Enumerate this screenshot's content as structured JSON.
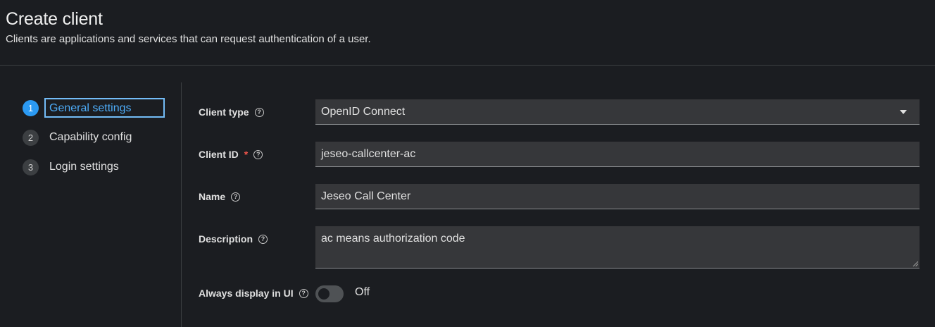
{
  "header": {
    "title": "Create client",
    "subtitle": "Clients are applications and services that can request authentication of a user."
  },
  "wizard": {
    "steps": [
      {
        "number": "1",
        "label": "General settings",
        "current": true
      },
      {
        "number": "2",
        "label": "Capability config",
        "current": false
      },
      {
        "number": "3",
        "label": "Login settings",
        "current": false
      }
    ]
  },
  "form": {
    "client_type": {
      "label": "Client type",
      "value": "OpenID Connect"
    },
    "client_id": {
      "label": "Client ID",
      "required_marker": "*",
      "value": "jeseo-callcenter-ac"
    },
    "name": {
      "label": "Name",
      "value": "Jeseo Call Center"
    },
    "description": {
      "label": "Description",
      "value": "ac means authorization code"
    },
    "always_display": {
      "label": "Always display in UI",
      "state_text": "Off",
      "checked": false
    }
  },
  "icons": {
    "help": "help-circle-icon",
    "dropdown": "caret-down-icon"
  },
  "colors": {
    "accent": "#2b9af3",
    "required": "#f0554b",
    "background": "#1b1d21"
  }
}
